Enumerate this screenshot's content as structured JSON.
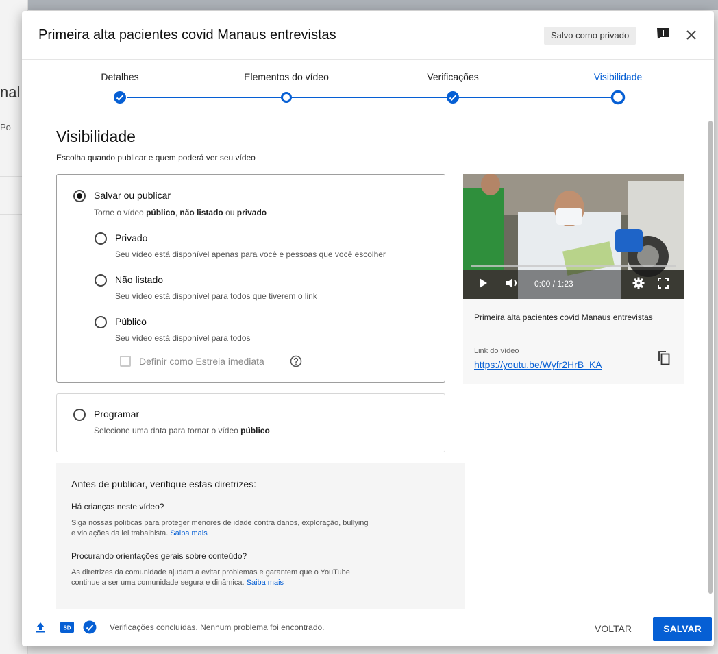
{
  "background": {
    "fragment_top": "nal",
    "fragment_mid": "Po"
  },
  "header": {
    "title": "Primeira alta pacientes covid Manaus entrevistas",
    "saved_badge": "Salvo como privado"
  },
  "stepper": {
    "steps": [
      {
        "label": "Detalhes",
        "state": "done"
      },
      {
        "label": "Elementos do vídeo",
        "state": "empty"
      },
      {
        "label": "Verificações",
        "state": "done"
      },
      {
        "label": "Visibilidade",
        "state": "active"
      }
    ]
  },
  "visibility": {
    "title": "Visibilidade",
    "subtitle": "Escolha quando publicar e quem poderá ver seu vídeo",
    "save_publish": {
      "title": "Salvar ou publicar",
      "desc_pre": "Torne o vídeo ",
      "desc_b1": "público",
      "desc_sep1": ", ",
      "desc_b2": "não listado",
      "desc_sep2": " ou ",
      "desc_b3": "privado"
    },
    "options": [
      {
        "title": "Privado",
        "desc": "Seu vídeo está disponível apenas para você e pessoas que você escolher"
      },
      {
        "title": "Não listado",
        "desc": "Seu vídeo está disponível para todos que tiverem o link"
      },
      {
        "title": "Público",
        "desc": "Seu vídeo está disponível para todos"
      }
    ],
    "premiere_label": "Definir como Estreia imediata",
    "schedule": {
      "title": "Programar",
      "desc_pre": "Selecione uma data para tornar o vídeo ",
      "desc_b": "público"
    }
  },
  "guidelines": {
    "title": "Antes de publicar, verifique estas diretrizes:",
    "q1": "Há crianças neste vídeo?",
    "t1": "Siga nossas políticas para proteger menores de idade contra danos, exploração, bullying e violações da lei trabalhista.",
    "q2": "Procurando orientações gerais sobre conteúdo?",
    "t2": "As diretrizes da comunidade ajudam a evitar problemas e garantem que o YouTube continue a ser uma comunidade segura e dinâmica.",
    "learn_more": "Saiba mais"
  },
  "video": {
    "time": "0:00 / 1:23",
    "title": "Primeira alta pacientes covid Manaus entrevistas",
    "link_label": "Link do vídeo",
    "link": "https://youtu.be/Wyfr2HrB_KA"
  },
  "footer": {
    "status": "Verificações concluídas. Nenhum problema foi encontrado.",
    "back": "VOLTAR",
    "save": "SALVAR"
  },
  "colors": {
    "accent": "#065fd4",
    "text": "#0d0d0d",
    "muted": "#606060"
  }
}
